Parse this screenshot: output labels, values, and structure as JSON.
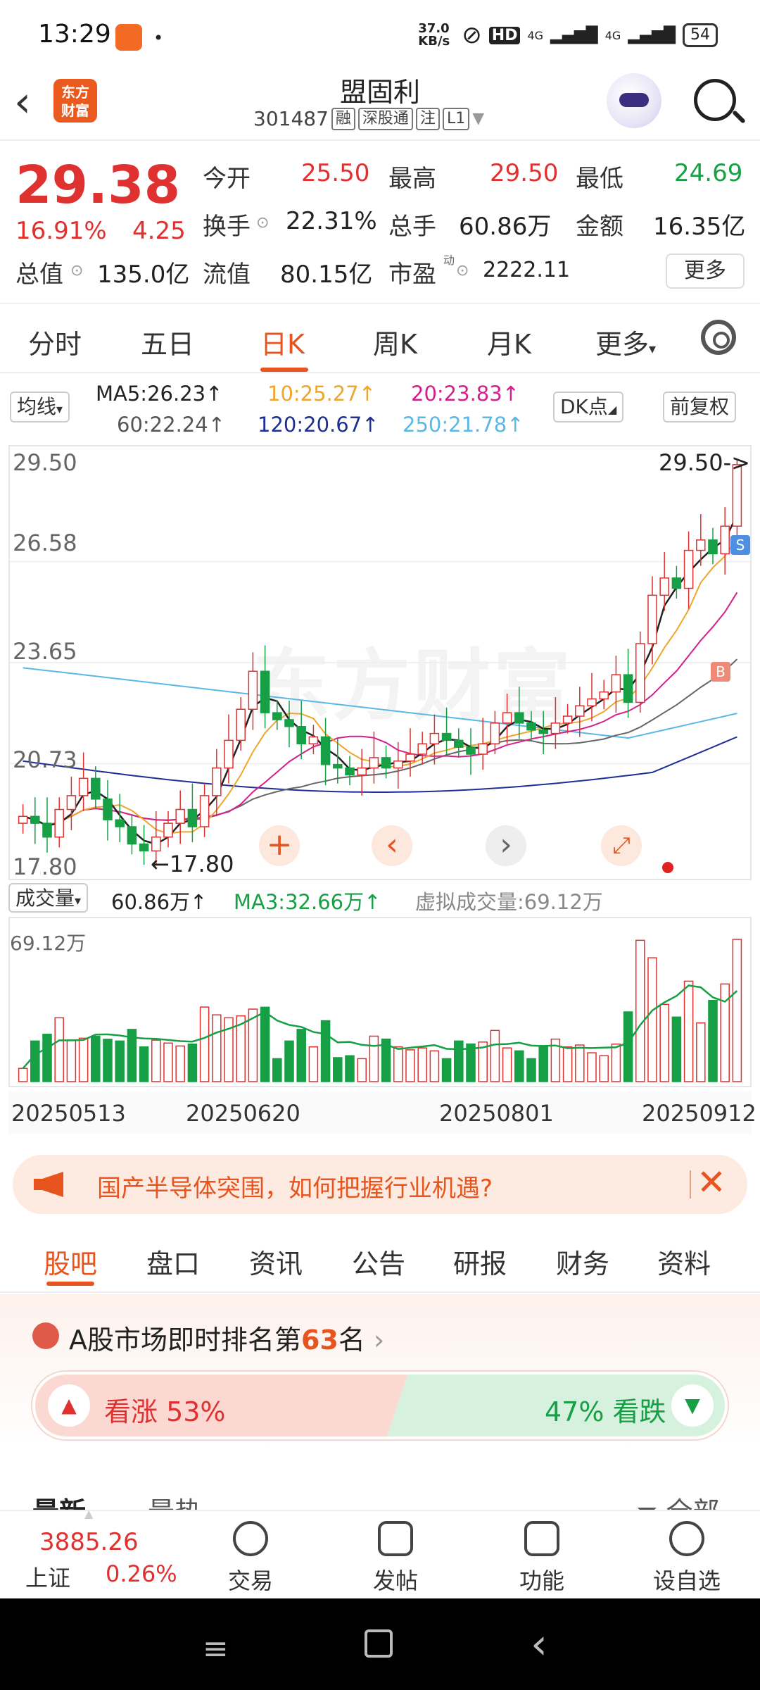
{
  "status": {
    "time": "13:29",
    "net_speed": "37.0 KB/s",
    "hd": "HD",
    "sig1": "4G",
    "sig2": "4G",
    "battery": "54"
  },
  "nav": {
    "logo_line1": "东方",
    "logo_line2": "财富",
    "title": "盟固利",
    "code": "301487",
    "tags": [
      "融",
      "深股通",
      "注",
      "L1"
    ]
  },
  "quote": {
    "price": "29.38",
    "pct": "16.91%",
    "change": "4.25",
    "items": [
      {
        "label": "今开",
        "value": "25.50",
        "color": "red"
      },
      {
        "label": "最高",
        "value": "29.50",
        "color": "red"
      },
      {
        "label": "最低",
        "value": "24.69",
        "color": "green"
      },
      {
        "label": "换手",
        "value": "22.31%"
      },
      {
        "label": "总手",
        "value": "60.86万"
      },
      {
        "label": "金额",
        "value": "16.35亿"
      },
      {
        "label": "总值",
        "value": "135.0亿"
      },
      {
        "label": "流值",
        "value": "80.15亿"
      },
      {
        "label": "市盈",
        "value": "2222.11"
      }
    ],
    "pe_sup": "动",
    "more": "更多"
  },
  "tabs": [
    "分时",
    "五日",
    "日K",
    "周K",
    "月K",
    "更多"
  ],
  "ma": {
    "select": "均线",
    "ma5": "MA5:26.23",
    "ma10": "10:25.27",
    "ma20": "20:23.83",
    "ma60": "60:22.24",
    "ma120": "120:20.67",
    "ma250": "250:21.78",
    "arrow": "↑",
    "dk": "DK点",
    "adjust": "前复权",
    "colors": {
      "ma5": "#222222",
      "ma10": "#f0a52c",
      "ma20": "#d4208a",
      "ma60": "#666666",
      "ma120": "#1d2f94",
      "ma250": "#5ab8e6"
    }
  },
  "kchart": {
    "y_labels": [
      "29.50",
      "26.58",
      "23.65",
      "20.73",
      "17.80"
    ],
    "high_label": "29.50->",
    "low_label": "17.80",
    "watermark": "东方财富",
    "buy_marker": "B",
    "sell_marker": "S"
  },
  "chart_data": {
    "type": "candlestick",
    "ylim": [
      17.8,
      29.5
    ],
    "approx_closes": [
      19.2,
      19.0,
      18.6,
      19.4,
      19.8,
      20.3,
      19.7,
      19.1,
      18.9,
      18.4,
      18.2,
      18.6,
      19.0,
      19.4,
      18.9,
      19.8,
      20.6,
      21.4,
      22.3,
      23.4,
      22.2,
      22.0,
      21.8,
      21.3,
      21.5,
      20.7,
      20.6,
      20.4,
      20.6,
      20.9,
      20.6,
      20.8,
      21.0,
      21.3,
      21.6,
      21.4,
      21.2,
      21.0,
      21.3,
      21.9,
      22.2,
      21.9,
      21.7,
      21.6,
      21.9,
      22.1,
      22.4,
      22.6,
      22.8,
      23.3,
      22.5,
      24.2,
      25.6,
      26.1,
      25.8,
      26.9,
      27.2,
      26.8,
      27.6,
      29.38
    ],
    "volume_max_label": "69.12万",
    "volume": "60.86万",
    "volume_ma3": "MA3:32.66万",
    "virtual_volume": "虚拟成交量:69.12万",
    "dates": [
      "20250513",
      "20250620",
      "20250801",
      "20250912"
    ]
  },
  "vol": {
    "select": "成交量",
    "value": "60.86万",
    "ma3": "MA3:32.66万",
    "virtual": "虚拟成交量:69.12万"
  },
  "ad": {
    "text": "国产半导体突围，如何把握行业机遇?",
    "close": "✕"
  },
  "ftabs": [
    "股吧",
    "盘口",
    "资讯",
    "公告",
    "研报",
    "财务",
    "资料"
  ],
  "rank": {
    "prefix": "A股市场即时排名第",
    "num": "63",
    "suffix": "名",
    "up": "看涨 53%",
    "down": "47% 看跌",
    "up_pct": 53
  },
  "sort": {
    "latest": "最新",
    "hot": "最热",
    "all": "全部"
  },
  "bottom": {
    "sh_price": "3885.26",
    "sh_name": "上证",
    "sh_pct": "0.26%",
    "items": [
      "交易",
      "发帖",
      "功能",
      "设自选"
    ]
  }
}
